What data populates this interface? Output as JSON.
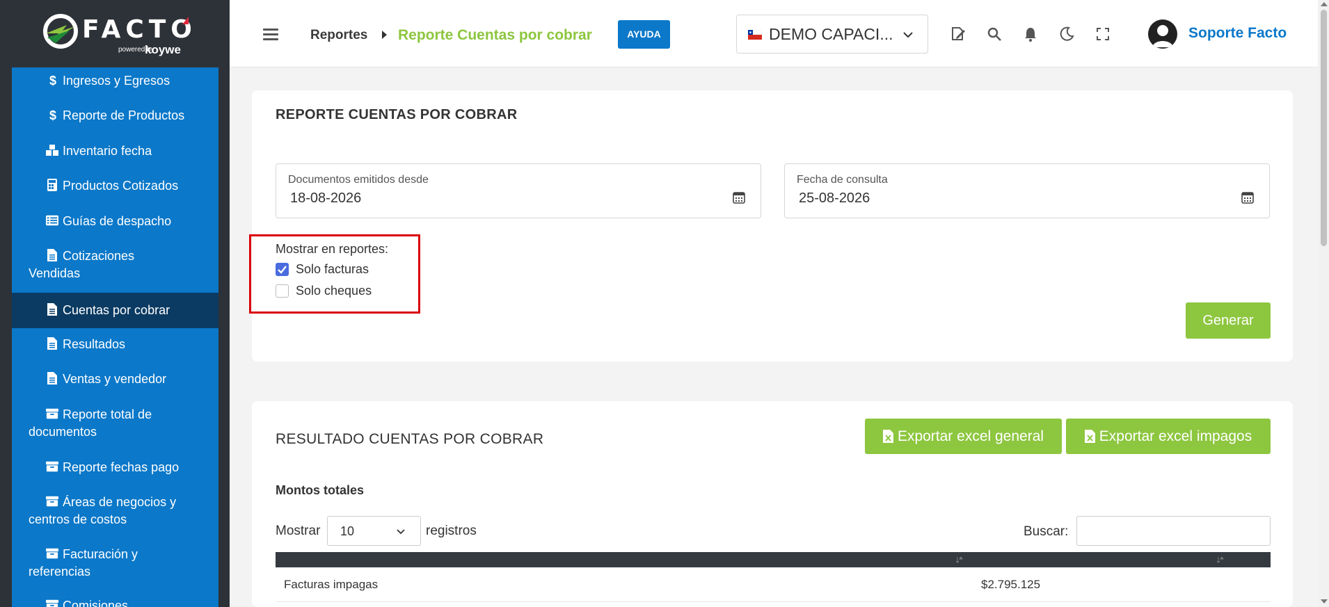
{
  "brand": {
    "name": "FACTO",
    "powered_by": "powered by",
    "partner": "koywe"
  },
  "sidebar": {
    "items": [
      {
        "label": "Ingresos y Egresos",
        "icon": "dollar-icon"
      },
      {
        "label": "Reporte de Productos",
        "icon": "dollar-icon"
      },
      {
        "label": "Inventario fecha",
        "icon": "cubes-icon"
      },
      {
        "label": "Productos Cotizados",
        "icon": "calculator-icon"
      },
      {
        "label": "Guías de despacho",
        "icon": "list-icon"
      },
      {
        "label": "Cotizaciones",
        "label2": "Vendidas",
        "icon": "file-icon"
      },
      {
        "label": "Cuentas por cobrar",
        "icon": "file-icon",
        "active": true
      },
      {
        "label": "Resultados",
        "icon": "file-icon"
      },
      {
        "label": "Ventas y vendedor",
        "icon": "file-icon"
      },
      {
        "label": "Reporte total de",
        "label2": "documentos",
        "icon": "archive-icon"
      },
      {
        "label": "Reporte fechas pago",
        "icon": "archive-icon"
      },
      {
        "label": "Áreas de negocios y",
        "label2": "centros de costos",
        "icon": "archive-icon"
      },
      {
        "label": "Facturación y",
        "label2": "referencias",
        "icon": "archive-icon"
      },
      {
        "label": "Comisiones",
        "icon": "archive-icon"
      }
    ]
  },
  "header": {
    "breadcrumb_root": "Reportes",
    "breadcrumb_current": "Reporte Cuentas por cobrar",
    "help_label": "AYUDA",
    "company": "DEMO CAPACI...",
    "user_name": "Soporte Facto"
  },
  "filters": {
    "title": "REPORTE CUENTAS POR COBRAR",
    "from_label": "Documentos emitidos desde",
    "from_value": "18-08-2026",
    "query_label": "Fecha de consulta",
    "query_value": "25-08-2026",
    "show_label": "Mostrar en reportes:",
    "opt_facturas": "Solo facturas",
    "opt_cheques": "Solo cheques",
    "facturas_checked": true,
    "cheques_checked": false,
    "generate_label": "Generar"
  },
  "results": {
    "title": "RESULTADO CUENTAS POR COBRAR",
    "export_general": "Exportar excel general",
    "export_unpaid": "Exportar excel impagos",
    "totals_label": "Montos totales",
    "show_label": "Mostrar",
    "page_size": "10",
    "records_label": "registros",
    "search_label": "Buscar:",
    "rows": [
      {
        "label": "Facturas impagas",
        "value": "$2.795.125"
      }
    ]
  },
  "colors": {
    "sidebar": "#0b78c9",
    "sidebar_active": "#0b3b63",
    "accent_green": "#8dc63f",
    "highlight": "#d9000d"
  }
}
